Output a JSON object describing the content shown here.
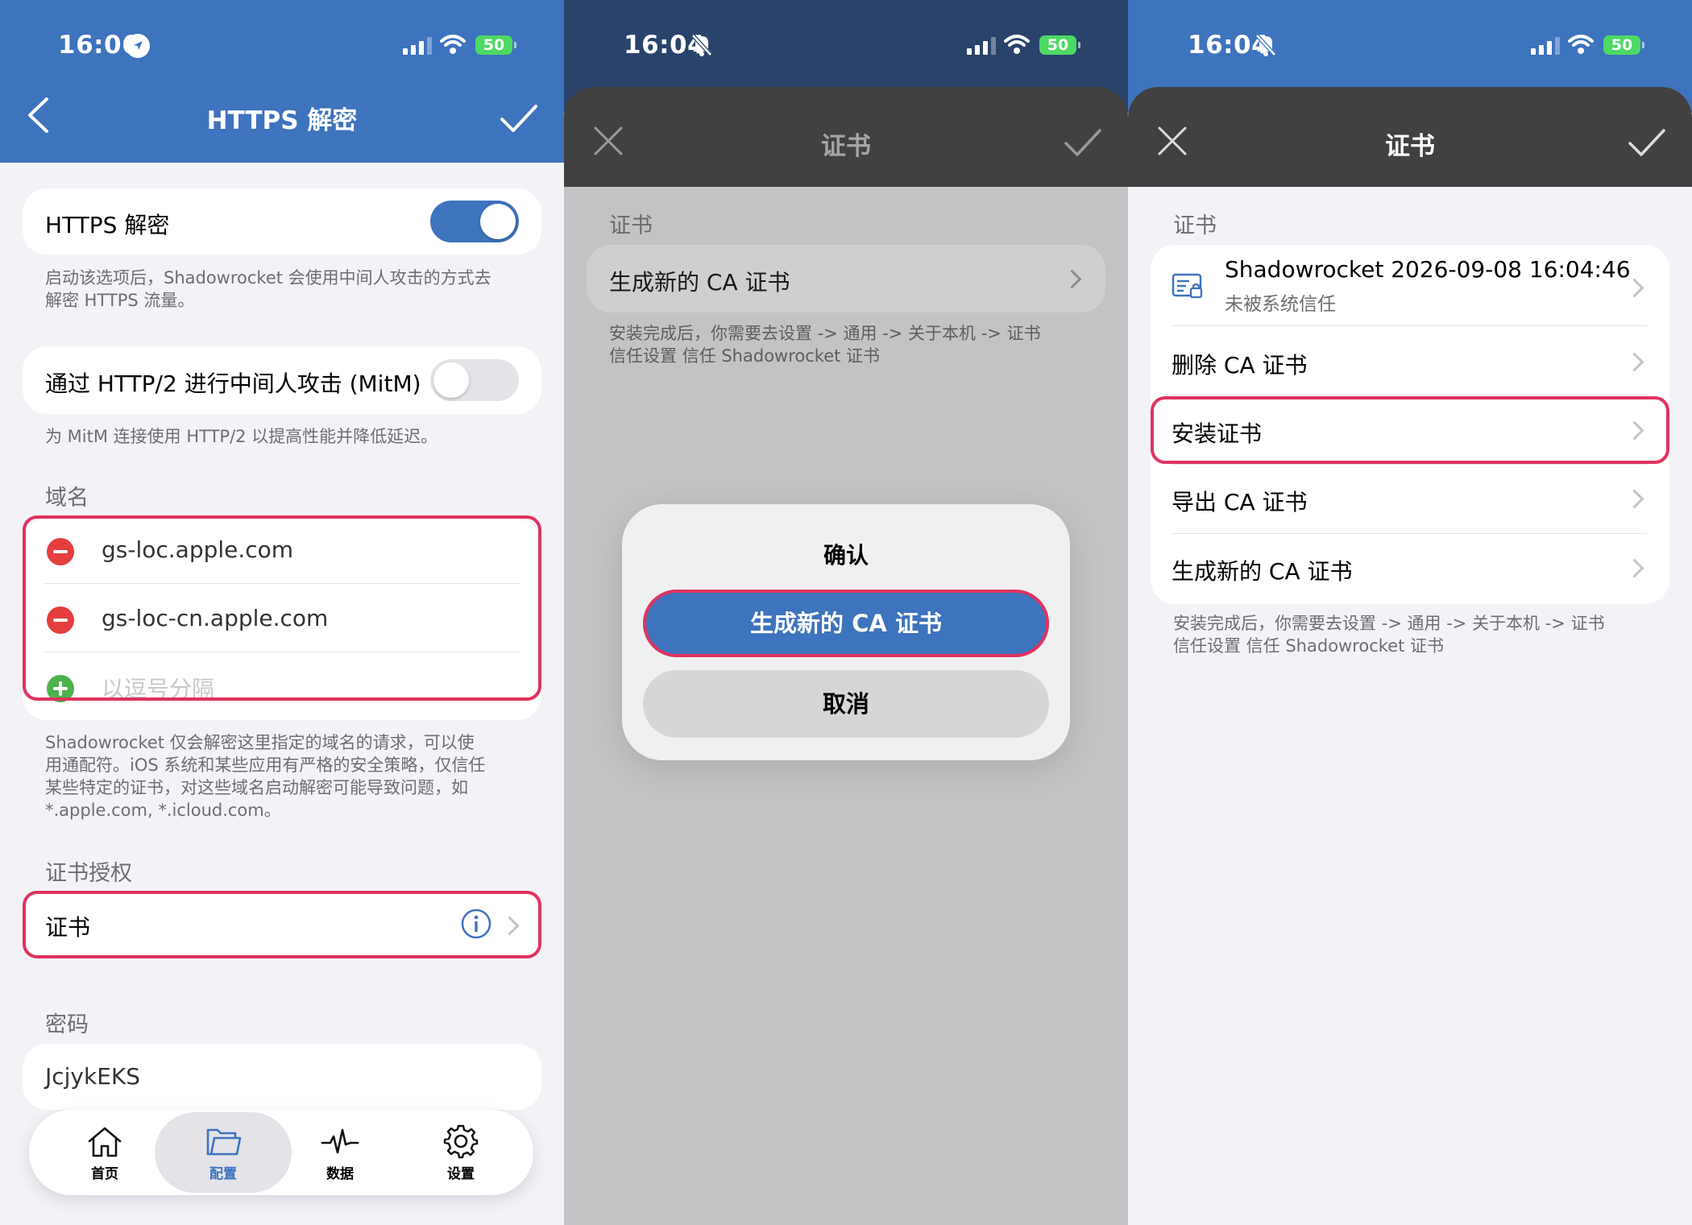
{
  "panel1": {
    "status": {
      "time": "16:06",
      "battery": "50"
    },
    "nav": {
      "title": "HTTPS 解密"
    },
    "https_toggle": {
      "label": "HTTPS 解密",
      "on": true
    },
    "https_footer": [
      "启动该选项后，Shadowrocket 会使用中间人攻击的方式去",
      "解密 HTTPS 流量。"
    ],
    "http2_toggle": {
      "label": "通过 HTTP/2 进行中间人攻击 (MitM)",
      "on": false
    },
    "http2_footer": "为 MitM 连接使用 HTTP/2 以提高性能并降低延迟。",
    "domain_section": "域名",
    "domains": [
      "gs-loc.apple.com",
      "gs-loc-cn.apple.com"
    ],
    "domain_placeholder": "以逗号分隔",
    "domain_footer": [
      "Shadowrocket 仅会解密这里指定的域名的请求，可以使",
      "用通配符。iOS 系统和某些应用有严格的安全策略，仅信任",
      "某些特定的证书，对这些域名启动解密可能导致问题，如",
      "*.apple.com, *.icloud.com。"
    ],
    "cert_section": "证书授权",
    "cert_row": "证书",
    "password_section": "密码",
    "password_value": "JcjykEKS",
    "tabs": [
      {
        "label": "首页",
        "icon": "home-icon",
        "active": false
      },
      {
        "label": "配置",
        "icon": "folder-icon",
        "active": true
      },
      {
        "label": "数据",
        "icon": "activity-icon",
        "active": false
      },
      {
        "label": "设置",
        "icon": "gear-icon",
        "active": false
      }
    ]
  },
  "panel2": {
    "status": {
      "time": "16:04",
      "battery": "50"
    },
    "sheet_title": "证书",
    "section": "证书",
    "row": "生成新的 CA 证书",
    "footer": [
      "安装完成后，你需要去设置 -> 通用 -> 关于本机 -> 证书",
      "信任设置 信任 Shadowrocket 证书"
    ],
    "dialog": {
      "title": "确认",
      "primary": "生成新的 CA 证书",
      "cancel": "取消"
    }
  },
  "panel3": {
    "status": {
      "time": "16:04",
      "battery": "50"
    },
    "sheet_title": "证书",
    "section": "证书",
    "cert_name": "Shadowrocket 2026-09-08 16:04:46",
    "cert_status": "未被系统信任",
    "rows": [
      "删除 CA 证书",
      "安装证书",
      "导出 CA 证书",
      "生成新的 CA 证书"
    ],
    "footer": [
      "安装完成后，你需要去设置 -> 通用 -> 关于本机 -> 证书",
      "信任设置 信任 Shadowrocket 证书"
    ]
  },
  "colors": {
    "blue": "#3e73bd",
    "highlight": "#e0335e",
    "sheet_header": "#414141",
    "green": "#4cd964",
    "red": "#e53e3e"
  }
}
